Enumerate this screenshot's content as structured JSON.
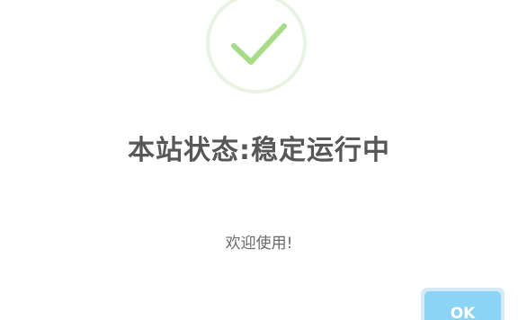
{
  "dialog": {
    "icon": "checkmark-icon",
    "title": "本站状态:稳定运行中",
    "message": "欢迎使用!",
    "ok_label": "OK"
  },
  "colors": {
    "check": "#a5dc86",
    "ring": "#e8f4e1",
    "button": "#8cd4f5",
    "title_text": "#575757"
  }
}
